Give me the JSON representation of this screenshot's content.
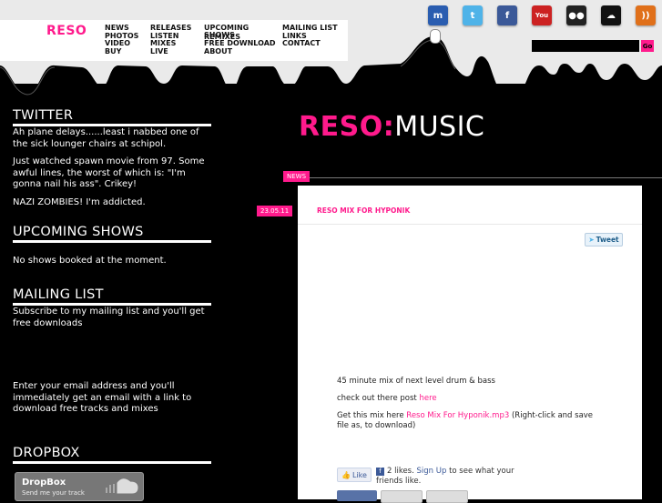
{
  "header": {
    "logo": "RESO",
    "nav_col1": [
      "NEWS",
      "PHOTOS",
      "VIDEO",
      "BUY"
    ],
    "nav_col2": [
      "RELEASES",
      "LISTEN",
      "MIXES",
      "LIVE"
    ],
    "nav_col3": [
      "UPCOMING",
      "SHOWS",
      "REMIXES",
      "FREE DOWNLOAD",
      "ABOUT"
    ],
    "nav_col4": [
      "MAILING LIST",
      "LINKS",
      "CONTACT"
    ],
    "social_icons": [
      {
        "name": "myspace-icon",
        "glyph": "m",
        "color": "#2a5db0"
      },
      {
        "name": "twitter-icon",
        "glyph": "t",
        "color": "#4fb3e8"
      },
      {
        "name": "facebook-icon",
        "glyph": "f",
        "color": "#3b5998"
      },
      {
        "name": "youtube-icon",
        "glyph": "You",
        "color": "#cc2222"
      },
      {
        "name": "flickr-icon",
        "glyph": "●●",
        "color": "#222222"
      },
      {
        "name": "soundcloud-icon",
        "glyph": "☁",
        "color": "#111111"
      },
      {
        "name": "rss-icon",
        "glyph": "))",
        "color": "#e0701a"
      }
    ],
    "search_button": "Go"
  },
  "sidebar": {
    "twitter": {
      "heading": "TWITTER",
      "tweets": [
        "Ah plane delays......least i nabbed one of the sick lounger chairs at schipol.",
        "Just watched spawn movie from 97. Some awful lines, the worst of which is: \"I'm gonna nail his ass\". Crikey!",
        "NAZI ZOMBIES! I'm addicted."
      ]
    },
    "shows": {
      "heading": "UPCOMING SHOWS",
      "text": "No shows booked at the moment."
    },
    "mailing": {
      "heading": "MAILING LIST",
      "text1": "Subscribe to my mailing list and you'll get free downloads",
      "text2": "Enter your email address and you'll immediately get an email with a link to download free tracks and mixes"
    },
    "dropbox": {
      "heading": "DROPBOX",
      "widget_title": "DropBox",
      "widget_sub": "Send me your track"
    }
  },
  "main": {
    "brand_pink": "RESO:",
    "brand_white": "MUSIC",
    "news_tag": "NEWS",
    "post": {
      "date": "23.05.11",
      "title": "RESO MIX FOR HYPONIK",
      "tweet_button": "Tweet",
      "line1": "45 minute mix of next level drum & bass",
      "line2_prefix": "check out there post ",
      "line2_link": "here",
      "line3_prefix": "Get this mix here ",
      "line3_link": "Reso Mix For Hyponik.mp3",
      "line3_suffix": " (Right-click and save file as, to download)",
      "like_button": "Like",
      "likes_prefix": "2 likes. ",
      "likes_link": "Sign Up",
      "likes_suffix": " to see what your friends like."
    }
  },
  "colors": {
    "accent": "#ff1a8c",
    "background": "#000000",
    "header": "#eaeaea"
  }
}
